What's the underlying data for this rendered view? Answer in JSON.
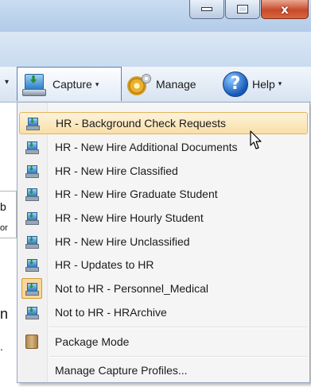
{
  "window_controls": {
    "minimize_icon": "minimize-icon",
    "maximize_icon": "maximize-icon",
    "close_glyph": "x"
  },
  "toolbar": {
    "capture_label": "Capture",
    "manage_label": "Manage",
    "help_label": "Help",
    "help_glyph": "?"
  },
  "background_window": {
    "fragments": [
      "b",
      "or",
      "n",
      "."
    ]
  },
  "capture_menu": {
    "items": [
      {
        "label": "HR - Background Check Requests",
        "icon": "scanner-icon",
        "highlighted": true
      },
      {
        "label": "HR - New Hire Additional Documents",
        "icon": "scanner-icon"
      },
      {
        "label": "HR - New Hire Classified",
        "icon": "scanner-icon"
      },
      {
        "label": "HR - New Hire Graduate Student",
        "icon": "scanner-icon"
      },
      {
        "label": "HR - New Hire Hourly Student",
        "icon": "scanner-icon"
      },
      {
        "label": "HR - New Hire Unclassified",
        "icon": "scanner-icon"
      },
      {
        "label": "HR - Updates to HR",
        "icon": "scanner-icon"
      },
      {
        "label": "Not to HR - Personnel_Medical",
        "icon": "scanner-icon",
        "selected": true
      },
      {
        "label": "Not to HR - HRArchive",
        "icon": "scanner-icon"
      }
    ],
    "package_mode_label": "Package Mode",
    "manage_profiles_label": "Manage Capture Profiles..."
  },
  "colors": {
    "highlight": "#f8dfa7",
    "highlight_border": "#e5b45a",
    "close_button": "#c74a2a"
  }
}
